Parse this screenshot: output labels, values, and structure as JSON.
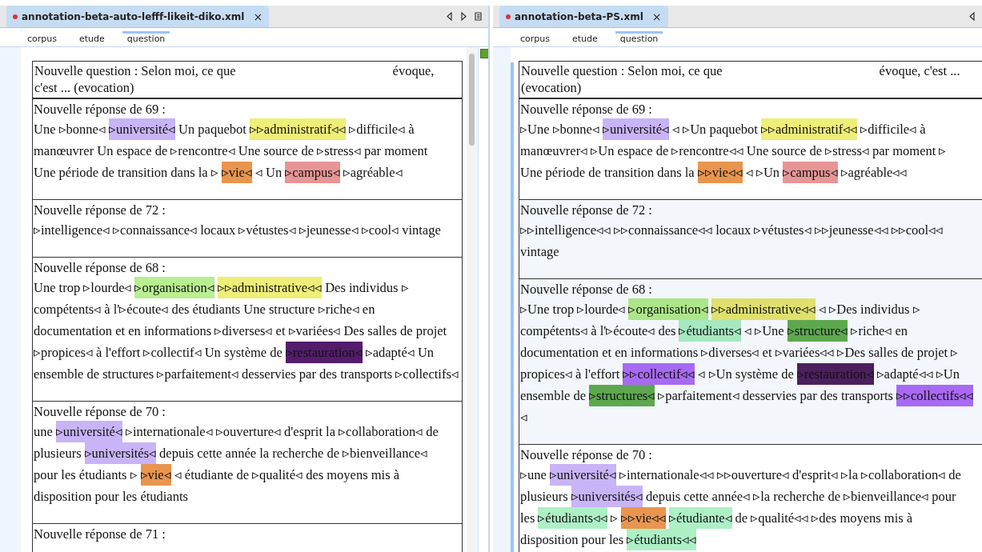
{
  "panes": [
    {
      "tab": {
        "title": "annotation-beta-auto-lefff-likeit-diko.xml",
        "close_label": "×",
        "modified": true,
        "selected": true
      },
      "nav_icons": [
        {
          "kind": "left"
        },
        {
          "kind": "right"
        },
        {
          "kind": "list"
        }
      ],
      "breadcrumbs": [
        {
          "label": "corpus",
          "selected": false
        },
        {
          "label": "etude",
          "selected": false
        },
        {
          "label": "question",
          "selected": true
        }
      ],
      "question": {
        "lines": [
          [
            "Nouvelle question : Selon moi, ce que",
            "évoque,"
          ],
          [
            "c'est ... (evocation)"
          ]
        ]
      },
      "responses": [
        {
          "heading": "Nouvelle réponse de 69 :",
          "shaded": false,
          "lines": [
            [
              {
                "text": "Une ▹bonne◃"
              },
              {
                "text": "▹université◃",
                "color": "#c8b4f6"
              },
              {
                "text": "Un paquebot"
              },
              {
                "text": "▹▹administratif◃◃",
                "color": "#eeee78"
              },
              {
                "text": "▹difficile◃ à"
              }
            ],
            [
              {
                "text": "manœuvrer Un espace de ▹rencontre◃ Une source de ▹stress◃ par moment"
              }
            ],
            [
              {
                "text": "Une période de transition dans la ▹"
              },
              {
                "text": "▹vie◃",
                "color": "#e8954f"
              },
              {
                "text": "◃ Un"
              },
              {
                "text": "▹campus◃",
                "color": "#e69696"
              },
              {
                "text": "▹agréable◃"
              }
            ]
          ]
        },
        {
          "heading": "Nouvelle réponse de 72 :",
          "shaded": false,
          "lines": [
            [
              {
                "text": "▹intelligence◃ ▹connaissance◃ locaux ▹vétustes◃ ▹jeunesse◃ ▹cool◃ vintage"
              }
            ]
          ]
        },
        {
          "heading": "Nouvelle réponse de 68 :",
          "shaded": false,
          "lines": [
            [
              {
                "text": "Une trop ▹lourde◃"
              },
              {
                "text": "▹organisation◃",
                "color": "#b9ee91"
              },
              {
                "text": "▹▹administrative◃◃",
                "color": "#eeee78"
              },
              {
                "text": "Des individus ▹"
              }
            ],
            [
              {
                "text": "compétents◃ à l'▹écoute◃ des étudiants Une structure ▹riche◃ en"
              }
            ],
            [
              {
                "text": "documentation et en informations ▹diverses◃ et ▹variées◃ Des salles de projet"
              }
            ],
            [
              {
                "text": "▹propices◃ à l'effort ▹collectif◃ Un système de"
              },
              {
                "text": "▹restauration◃",
                "color": "#541c6c"
              },
              {
                "text": "▹adapté◃ Un"
              }
            ],
            [
              {
                "text": "ensemble de structures ▹parfaitement◃ desservies par des transports ▹collectifs◃"
              }
            ]
          ]
        },
        {
          "heading": "Nouvelle réponse de 70 :",
          "shaded": false,
          "lines": [
            [
              {
                "text": "une"
              },
              {
                "text": "▹université◃",
                "color": "#c8b4f6"
              },
              {
                "text": "▹internationale◃ ▹ouverture◃ d'esprit la ▹collaboration◃ de"
              }
            ],
            [
              {
                "text": "plusieurs"
              },
              {
                "text": "▹universités◃",
                "color": "#c8b4f6"
              },
              {
                "text": "depuis cette année la recherche de ▹bienveillance◃"
              }
            ],
            [
              {
                "text": "pour les étudiants ▹"
              },
              {
                "text": "▹vie◃",
                "color": "#e8954f"
              },
              {
                "text": "◃ étudiante de ▹qualité◃ des moyens mis à"
              }
            ],
            [
              {
                "text": "disposition pour les étudiants"
              }
            ]
          ]
        },
        {
          "heading": "Nouvelle réponse de 71 :",
          "shaded": false
        }
      ]
    },
    {
      "tab": {
        "title": "annotation-beta-PS.xml",
        "close_label": "×",
        "modified": true,
        "selected": true
      },
      "nav_icons": [
        {
          "kind": "left"
        }
      ],
      "breadcrumbs": [
        {
          "label": "corpus",
          "selected": false
        },
        {
          "label": "etude",
          "selected": false
        },
        {
          "label": "question",
          "selected": true
        }
      ],
      "question": {
        "lines": [
          [
            "Nouvelle question : Selon moi, ce que",
            "évoque, c'est ..."
          ],
          [
            "(evocation)"
          ]
        ]
      },
      "responses": [
        {
          "heading": "Nouvelle réponse de 69 :",
          "shaded": false,
          "lines": [
            [
              {
                "text": "▹Une ▹bonne◃"
              },
              {
                "text": "▹université◃",
                "color": "#c8b4f6"
              },
              {
                "text": "◃ ▹Un paquebot"
              },
              {
                "text": "▹▹administratif◃◃",
                "color": "#eeee78"
              },
              {
                "text": "▹difficile◃ à"
              }
            ],
            [
              {
                "text": "manœuvrer◃ ▹Un espace de ▹rencontre◃◃ Une source de ▹stress◃ par moment ▹"
              }
            ],
            [
              {
                "text": "Une période de transition dans la"
              },
              {
                "text": "▹▹vie◃◃",
                "color": "#e8954f"
              },
              {
                "text": "◃ ▹Un"
              },
              {
                "text": "▹campus◃",
                "color": "#e69696"
              },
              {
                "text": "▹agréable◃◃"
              }
            ]
          ]
        },
        {
          "heading": "Nouvelle réponse de 72 :",
          "shaded": true,
          "lines": [
            [
              {
                "text": "▹▹intelligence◃◃ ▹▹connaissance◃◃ locaux ▹vétustes◃ ▹▹jeunesse◃◃ ▹▹cool◃◃"
              }
            ],
            [
              {
                "text": "vintage"
              }
            ]
          ]
        },
        {
          "heading": "Nouvelle réponse de 68 :",
          "shaded": true,
          "lines": [
            [
              {
                "text": "▹Une trop ▹lourde◃"
              },
              {
                "text": "▹organisation◃",
                "color": "#ade68a"
              },
              {
                "text": "▹▹administrative◃◃",
                "color": "#dfe06e"
              },
              {
                "text": "◃ ▹Des individus ▹"
              }
            ],
            [
              {
                "text": "compétents◃ à l'▹écoute◃ des"
              },
              {
                "text": "▹étudiants◃",
                "color": "#a6e8c0"
              },
              {
                "text": "◃ ▹Une"
              },
              {
                "text": "▹structure◃",
                "color": "#5da84f"
              },
              {
                "text": "▹riche◃ en"
              }
            ],
            [
              {
                "text": "documentation et en informations ▹diverses◃ et ▹variées◃◃ ▹Des salles de projet ▹"
              }
            ],
            [
              {
                "text": "propices◃ à l'effort"
              },
              {
                "text": "▹▹collectif◃◃",
                "color": "#a86af2"
              },
              {
                "text": "◃ ▹Un système de"
              },
              {
                "text": "▹restauration◃",
                "color": "#4c1f5e"
              },
              {
                "text": "▹adapté◃◃ ▹Un"
              }
            ],
            [
              {
                "text": "ensemble de"
              },
              {
                "text": "▹structures◃",
                "color": "#5da84f"
              },
              {
                "text": "▹parfaitement◃ desservies par des transports"
              },
              {
                "text": "▹▹collectifs◃◃",
                "color": "#a86af2"
              }
            ],
            [
              {
                "text": "◃"
              }
            ]
          ]
        },
        {
          "heading": "Nouvelle réponse de 70 :",
          "shaded": false,
          "lines": [
            [
              {
                "text": "▹une"
              },
              {
                "text": "▹université◃",
                "color": "#c8b4f6"
              },
              {
                "text": "▹internationale◃◃ ▹▹ouverture◃ d'esprit◃ ▹la ▹collaboration◃ de"
              }
            ],
            [
              {
                "text": "plusieurs"
              },
              {
                "text": "▹universités◃",
                "color": "#c8b4f6"
              },
              {
                "text": "depuis cette année◃ ▹la recherche de ▹bienveillance◃ pour"
              }
            ],
            [
              {
                "text": "les"
              },
              {
                "text": "▹étudiants◃◃",
                "color": "#adf0c6"
              },
              {
                "text": "▹"
              },
              {
                "text": "▹▹vie◃◃",
                "color": "#e8954f"
              },
              {
                "text": "▹étudiante◃",
                "color": "#adf0c6"
              },
              {
                "text": "de ▹qualité◃◃ ▹des moyens mis à"
              }
            ],
            [
              {
                "text": "disposition pour les"
              },
              {
                "text": "▹étudiants◃◃",
                "color": "#adf0c6"
              }
            ]
          ]
        }
      ]
    }
  ]
}
